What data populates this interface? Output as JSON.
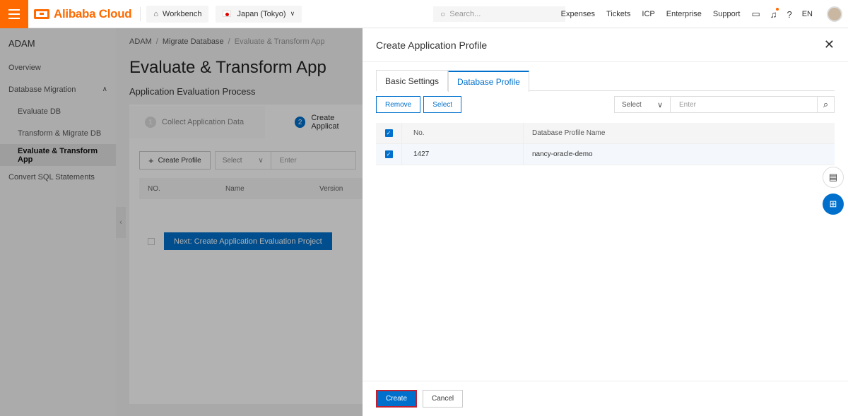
{
  "topbar": {
    "brand": "Alibaba Cloud",
    "workbench": "Workbench",
    "region": "Japan (Tokyo)",
    "search_placeholder": "Search...",
    "links": [
      "Expenses",
      "Tickets",
      "ICP",
      "Enterprise",
      "Support"
    ],
    "lang": "EN"
  },
  "sidebar": {
    "title": "ADAM",
    "items": [
      {
        "label": "Overview"
      },
      {
        "label": "Database Migration"
      },
      {
        "label": "Evaluate DB"
      },
      {
        "label": "Transform & Migrate DB"
      },
      {
        "label": "Evaluate & Transform App"
      },
      {
        "label": "Convert SQL Statements"
      }
    ]
  },
  "page": {
    "breadcrumb": [
      "ADAM",
      "Migrate Database",
      "Evaluate & Transform App"
    ],
    "title": "Evaluate & Transform App",
    "subtitle": "Application Evaluation Process",
    "steps": [
      {
        "num": "1",
        "label": "Collect Application Data"
      },
      {
        "num": "2",
        "label": "Create Applicat"
      }
    ],
    "create_profile": "Create Profile",
    "select_label": "Select",
    "enter_placeholder": "Enter",
    "columns": [
      "NO.",
      "Name",
      "Version"
    ],
    "next_button": "Next: Create Application Evaluation Project"
  },
  "drawer": {
    "title": "Create Application Profile",
    "tabs": [
      {
        "label": "Basic Settings"
      },
      {
        "label": "Database Profile"
      }
    ],
    "remove_button": "Remove",
    "select_button": "Select",
    "filter_select": "Select",
    "filter_placeholder": "Enter",
    "table": {
      "columns": [
        "No.",
        "Database Profile Name"
      ],
      "rows": [
        {
          "no": "1427",
          "name": "nancy-oracle-demo"
        }
      ]
    },
    "create_button": "Create",
    "cancel_button": "Cancel"
  },
  "colors": {
    "brand": "#ff6a00",
    "primary": "#0070cc"
  }
}
